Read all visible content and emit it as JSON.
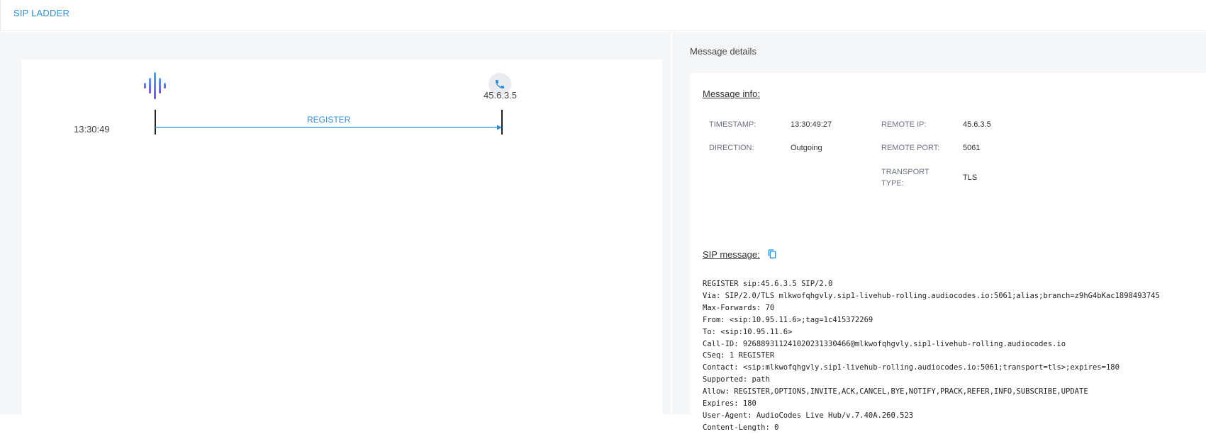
{
  "header": {
    "title": "SIP LADDER"
  },
  "ladder": {
    "endpoints": [
      {
        "name": "livehub",
        "icon": "waveform-icon",
        "label": ""
      },
      {
        "name": "remote",
        "icon": "phone-icon",
        "label": "45.6.3.5"
      }
    ],
    "messages": [
      {
        "time": "13:30:49",
        "method": "REGISTER",
        "direction": "Outgoing"
      }
    ],
    "colors": {
      "accent": "#2b8fe0",
      "waveform": "#6a5cf0"
    }
  },
  "details": {
    "title": "Message details",
    "message_info_title": "Message info:",
    "info": {
      "timestamp_label": "TIMESTAMP:",
      "timestamp_value": "13:30:49:27",
      "direction_label": "DIRECTION:",
      "direction_value": "Outgoing",
      "remote_ip_label": "REMOTE IP:",
      "remote_ip_value": "45.6.3.5",
      "remote_port_label": "REMOTE PORT:",
      "remote_port_value": "5061",
      "transport_label": "TRANSPORT TYPE:",
      "transport_value": "TLS"
    },
    "sip_message_title": "SIP message:",
    "copy_icon": "copy-icon",
    "sip_lines": [
      "REGISTER sip:45.6.3.5 SIP/2.0",
      "Via: SIP/2.0/TLS mlkwofqhgvly.sip1-livehub-rolling.audiocodes.io:5061;alias;branch=z9hG4bKac1898493745",
      "Max-Forwards: 70",
      "From: <sip:10.95.11.6>;tag=1c415372269",
      "To: <sip:10.95.11.6>",
      "Call-ID: 926889311241020231330466@mlkwofqhgvly.sip1-livehub-rolling.audiocodes.io",
      "CSeq: 1 REGISTER",
      "Contact: <sip:mlkwofqhgvly.sip1-livehub-rolling.audiocodes.io:5061;transport=tls>;expires=180",
      "Supported: path",
      "Allow: REGISTER,OPTIONS,INVITE,ACK,CANCEL,BYE,NOTIFY,PRACK,REFER,INFO,SUBSCRIBE,UPDATE",
      "Expires: 180",
      "User-Agent: AudioCodes Live Hub/v.7.40A.260.523",
      "Content-Length: 0"
    ]
  }
}
